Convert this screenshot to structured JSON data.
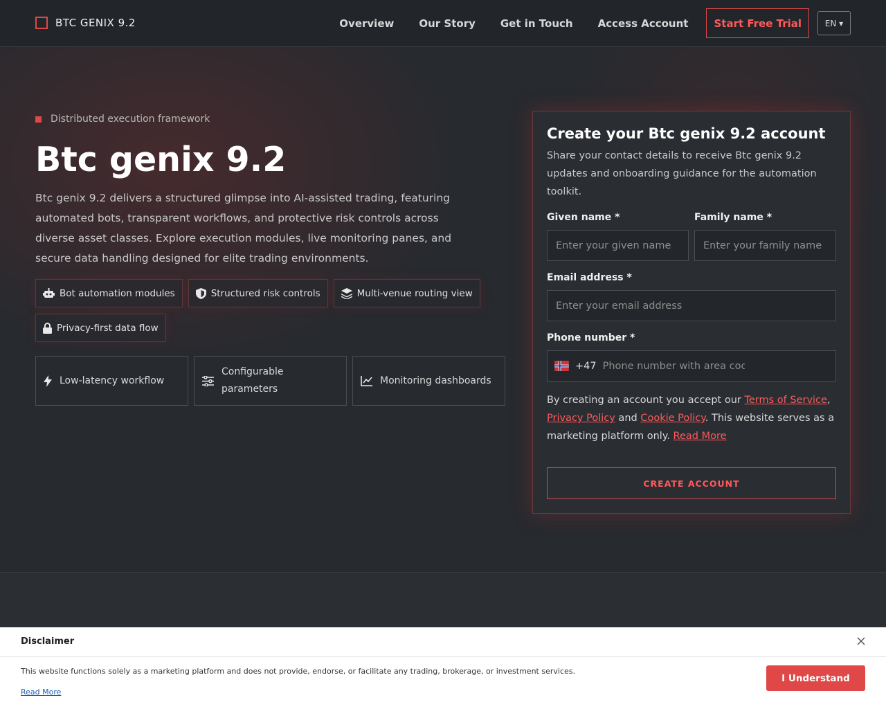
{
  "nav": {
    "logo": "BTC GENIX 9.2",
    "links": [
      "Overview",
      "Our Story",
      "Get in Touch",
      "Access Account"
    ],
    "trial_label": "Start Free Trial",
    "lang_label": "EN ▾"
  },
  "hero": {
    "eyebrow": "Distributed execution framework",
    "title": "Btc genix 9.2",
    "description": "Btc genix 9.2 delivers a structured glimpse into AI-assisted trading, featuring automated bots, transparent workflows, and protective risk controls across diverse asset classes. Explore execution modules, live monitoring panes, and secure data handling designed for elite trading environments.",
    "chips": [
      {
        "label": "Bot automation modules",
        "icon": "robot-icon"
      },
      {
        "label": "Structured risk controls",
        "icon": "shield-icon"
      },
      {
        "label": "Multi-venue routing view",
        "icon": "layers-icon"
      },
      {
        "label": "Privacy-first data flow",
        "icon": "lock-icon"
      }
    ],
    "features": [
      {
        "label": "Low-latency workflow",
        "icon": "bolt-icon"
      },
      {
        "label": "Configurable parameters",
        "icon": "sliders-icon"
      },
      {
        "label": "Monitoring dashboards",
        "icon": "chart-line-icon"
      }
    ]
  },
  "form": {
    "title": "Create your Btc genix 9.2 account",
    "subtitle": "Share your contact details to receive Btc genix 9.2 updates and onboarding guidance for the automation toolkit.",
    "given_label": "Given name *",
    "given_placeholder": "Enter your given name",
    "family_label": "Family name *",
    "family_placeholder": "Enter your family name",
    "email_label": "Email address *",
    "email_placeholder": "Enter your email address",
    "phone_label": "Phone number *",
    "phone_code": "+47",
    "phone_placeholder": "Phone number with area code",
    "terms_pre": "By creating an account you accept our ",
    "terms_link": "Terms of Service",
    "terms_comma": ",",
    "privacy_link": "Privacy Policy",
    "and_text": " and ",
    "cookie_link": "Cookie Policy",
    "terms_post": ". This website serves as a marketing platform only. ",
    "read_more": "Read More",
    "submit_label": "CREATE ACCOUNT"
  },
  "disclaimer": {
    "title": "Disclaimer",
    "text": "This website functions solely as a marketing platform and does not provide, endorse, or facilitate any trading, brokerage, or investment services.",
    "read_more": "Read More",
    "button_label": "I Understand"
  },
  "colors": {
    "accent": "#e04848",
    "background": "#24272c"
  }
}
